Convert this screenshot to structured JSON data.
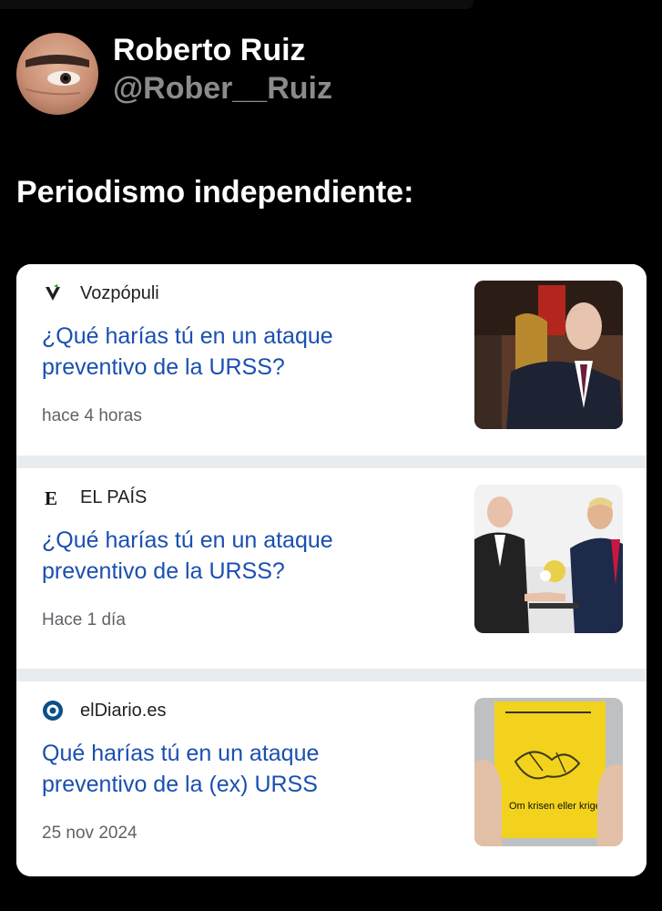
{
  "author": {
    "name": "Roberto Ruiz",
    "handle": "@Rober__Ruiz"
  },
  "post": {
    "text": "Periodismo independiente:"
  },
  "results": [
    {
      "source": "Vozpópuli",
      "source_icon": "vozpopuli-logo-icon",
      "headline": "¿Qué harías tú en un ataque preventivo de la URSS?",
      "time": "hace 4 horas",
      "thumbnail": "putin-seated-photo"
    },
    {
      "source": "EL PAÍS",
      "source_icon": "el-pais-logo-icon",
      "headline": "¿Qué harías tú en un ataque preventivo de la URSS?",
      "time": "Hace 1 día",
      "thumbnail": "handshake-photo"
    },
    {
      "source": "elDiario.es",
      "source_icon": "eldiario-logo-icon",
      "headline": "Qué harías tú en un ataque preventivo de la (ex) URSS",
      "time": "25 nov 2024",
      "thumbnail": "yellow-booklet-photo",
      "thumbnail_text": "Om krisen eller kriget kommer"
    }
  ],
  "colors": {
    "background": "#000000",
    "headline": "#1a4fb0",
    "handle": "#8b8b8b",
    "separator": "#e9ecef"
  }
}
